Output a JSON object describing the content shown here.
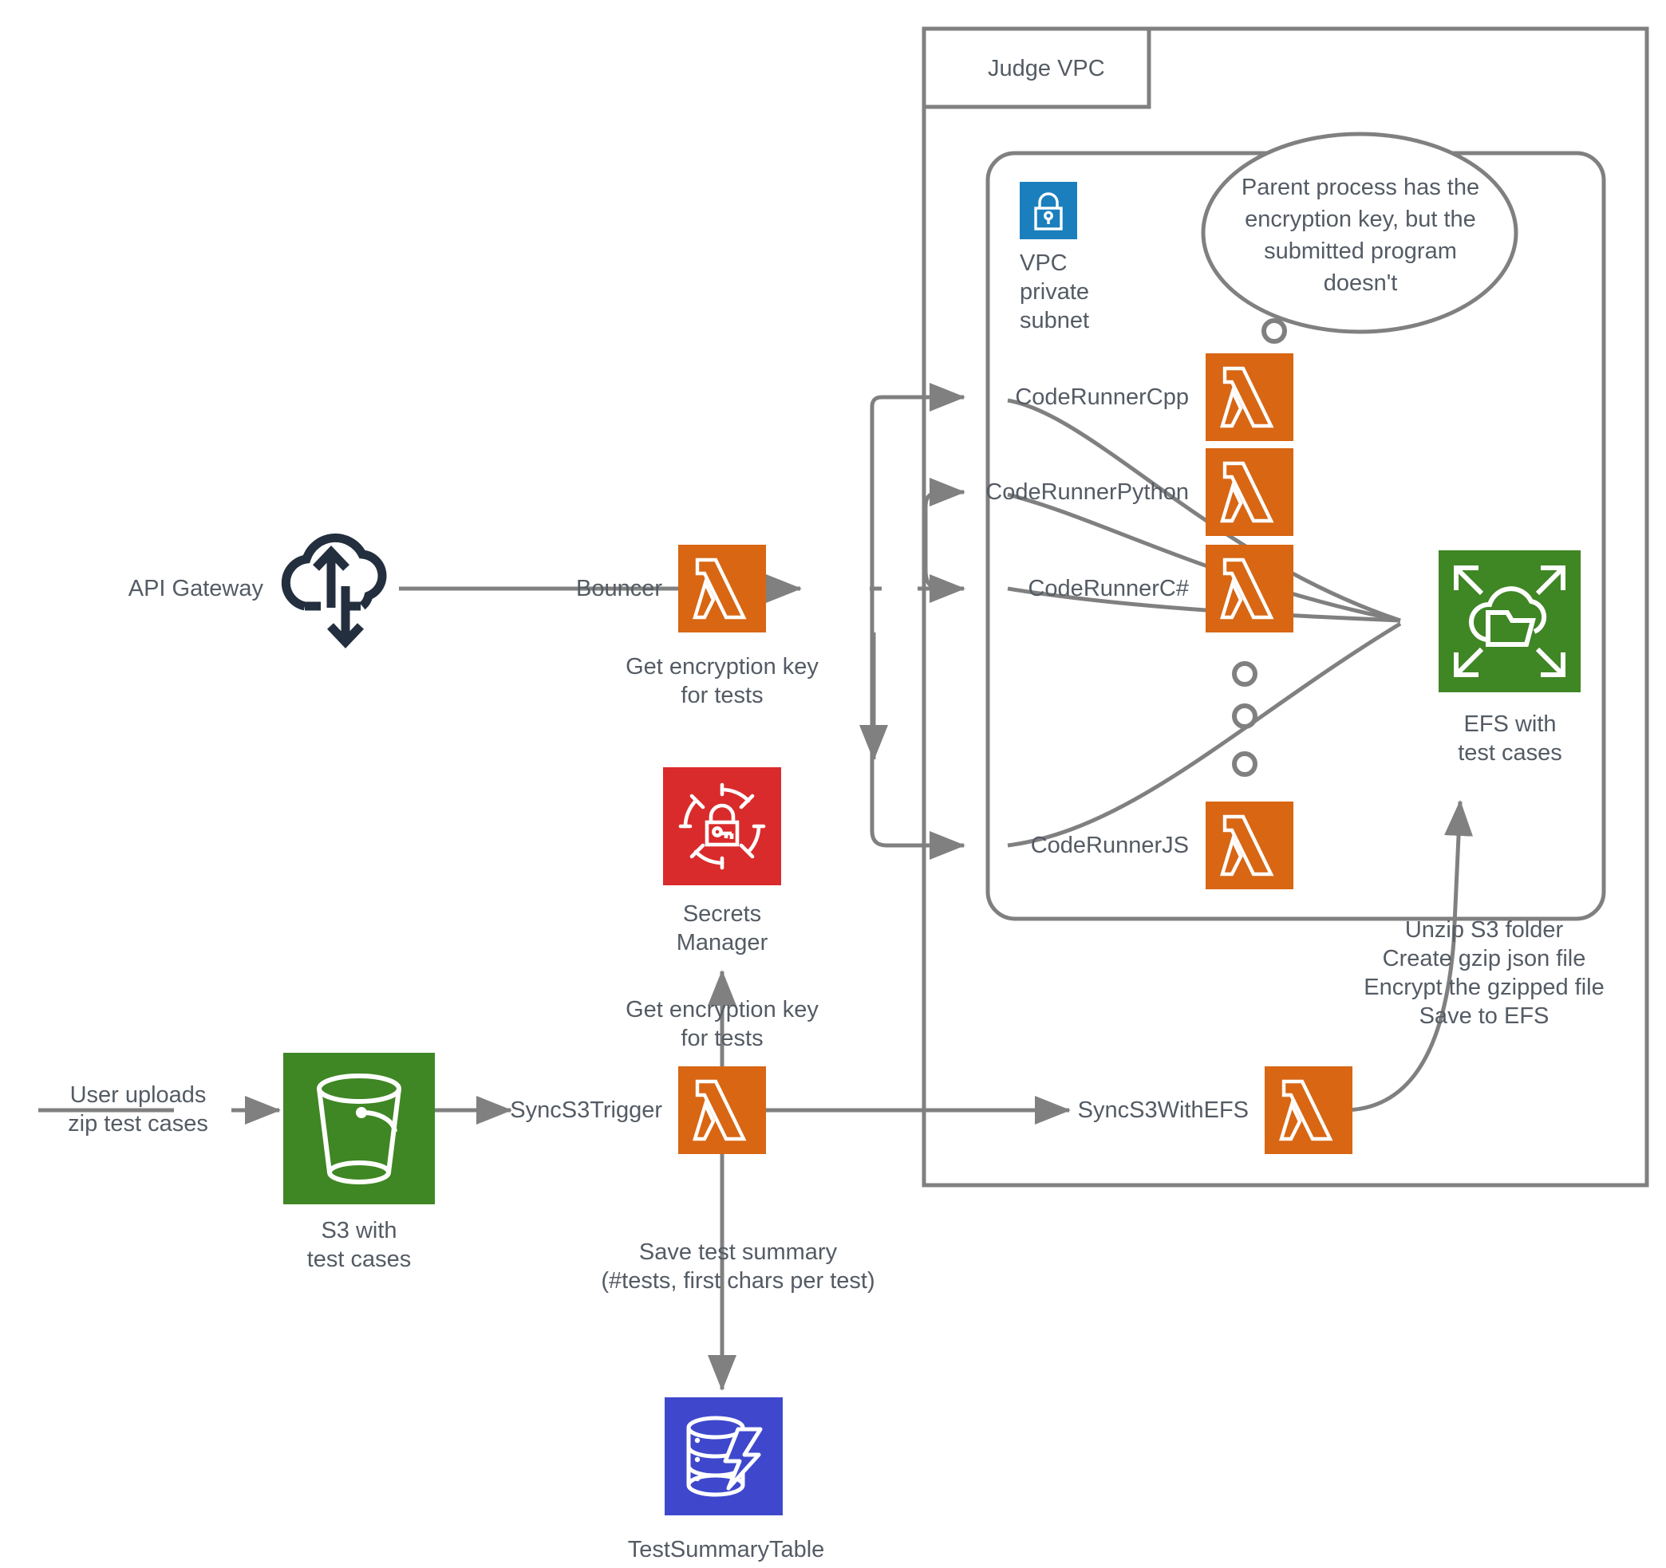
{
  "diagram": {
    "title_visible": false,
    "colors": {
      "lambda_orange": "#D86613",
      "s3_green": "#3F8624",
      "efs_green": "#3F8624",
      "secrets_red": "#D92B2B",
      "dynamodb_indigo": "#3F48CC",
      "vpc_lock_blue": "#1B7FBD",
      "apigw_navy": "#232F3E",
      "line_gray": "#808080",
      "text_gray": "#545b64"
    },
    "containers": [
      {
        "id": "judge-vpc",
        "label": "Judge VPC"
      },
      {
        "id": "vpc-private-subnet",
        "label": "VPC\nprivate\nsubnet"
      }
    ],
    "callout": {
      "text": "Parent process has the\nencryption key, but the\nsubmitted program\ndoesn't"
    },
    "nodes": [
      {
        "id": "api-gateway",
        "label": "API Gateway",
        "icon": "api-gateway-icon"
      },
      {
        "id": "bouncer",
        "label": "Bouncer",
        "icon": "lambda-icon"
      },
      {
        "id": "secrets-manager",
        "label": "Secrets\nManager",
        "icon": "secrets-manager-icon"
      },
      {
        "id": "s3-test-cases",
        "label": "S3 with\ntest cases",
        "icon": "s3-bucket-icon"
      },
      {
        "id": "sync-s3-trigger",
        "label": "SyncS3Trigger",
        "icon": "lambda-icon"
      },
      {
        "id": "sync-s3-with-efs",
        "label": "SyncS3WithEFS",
        "icon": "lambda-icon"
      },
      {
        "id": "test-summary-table",
        "label": "TestSummaryTable",
        "icon": "dynamodb-icon"
      },
      {
        "id": "efs-test-cases",
        "label": "EFS with\ntest cases",
        "icon": "efs-icon"
      },
      {
        "id": "code-runner-cpp",
        "label": "CodeRunnerCpp",
        "icon": "lambda-icon"
      },
      {
        "id": "code-runner-python",
        "label": "CodeRunnerPython",
        "icon": "lambda-icon"
      },
      {
        "id": "code-runner-csharp",
        "label": "CodeRunnerC#",
        "icon": "lambda-icon"
      },
      {
        "id": "code-runner-js",
        "label": "CodeRunnerJS",
        "icon": "lambda-icon"
      }
    ],
    "edge_labels": [
      {
        "id": "bouncer-to-secrets",
        "text": "Get encryption key\nfor tests"
      },
      {
        "id": "trigger-to-secrets",
        "text": "Get encryption key\nfor tests"
      },
      {
        "id": "user-uploads",
        "text": "User uploads\nzip test cases"
      },
      {
        "id": "save-test-summary",
        "text": "Save test summary\n(#tests, first chars per test)"
      },
      {
        "id": "sync-efs-steps",
        "text": "Unzip S3 folder\nCreate gzip json file\nEncrypt the gzipped file\nSave to EFS"
      }
    ],
    "ellipsis_dots": {
      "count_middle": 3,
      "count_top": 1
    }
  }
}
